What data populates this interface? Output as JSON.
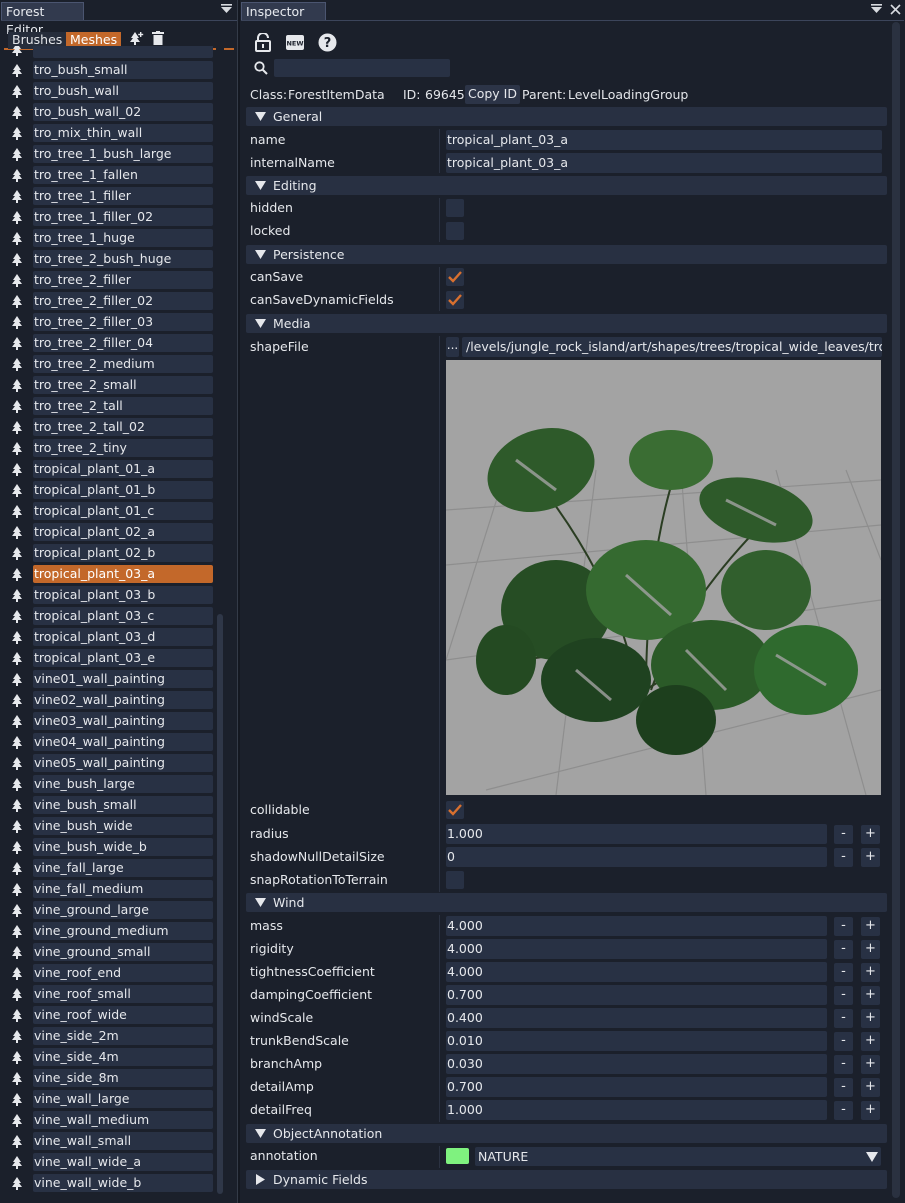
{
  "colors": {
    "accent": "#c3682a",
    "annotation_swatch": "#7ff27f"
  },
  "forest_editor": {
    "title": "Forest Editor",
    "tabs": [
      "Brushes",
      "Meshes"
    ],
    "active_tab": "Meshes",
    "selected_item": "tropical_plant_03_a",
    "items": [
      "tro_bush_small",
      "tro_bush_wall",
      "tro_bush_wall_02",
      "tro_mix_thin_wall",
      "tro_tree_1_bush_large",
      "tro_tree_1_fallen",
      "tro_tree_1_filler",
      "tro_tree_1_filler_02",
      "tro_tree_1_huge",
      "tro_tree_2_bush_huge",
      "tro_tree_2_filler",
      "tro_tree_2_filler_02",
      "tro_tree_2_filler_03",
      "tro_tree_2_filler_04",
      "tro_tree_2_medium",
      "tro_tree_2_small",
      "tro_tree_2_tall",
      "tro_tree_2_tall_02",
      "tro_tree_2_tiny",
      "tropical_plant_01_a",
      "tropical_plant_01_b",
      "tropical_plant_01_c",
      "tropical_plant_02_a",
      "tropical_plant_02_b",
      "tropical_plant_03_a",
      "tropical_plant_03_b",
      "tropical_plant_03_c",
      "tropical_plant_03_d",
      "tropical_plant_03_e",
      "vine01_wall_painting",
      "vine02_wall_painting",
      "vine03_wall_painting",
      "vine04_wall_painting",
      "vine05_wall_painting",
      "vine_bush_large",
      "vine_bush_small",
      "vine_bush_wide",
      "vine_bush_wide_b",
      "vine_fall_large",
      "vine_fall_medium",
      "vine_ground_large",
      "vine_ground_medium",
      "vine_ground_small",
      "vine_roof_end",
      "vine_roof_small",
      "vine_roof_wide",
      "vine_side_2m",
      "vine_side_4m",
      "vine_side_8m",
      "vine_wall_large",
      "vine_wall_medium",
      "vine_wall_small",
      "vine_wall_wide_a",
      "vine_wall_wide_b"
    ]
  },
  "inspector": {
    "title": "Inspector",
    "search": {
      "value": "",
      "placeholder": ""
    },
    "class_label": "Class:",
    "class_value": "ForestItemData",
    "id_label": "ID:",
    "id_value": "69645",
    "copy_id_label": "Copy ID",
    "parent_label": "Parent:",
    "parent_value": "LevelLoadingGroup",
    "sections": {
      "general": "General",
      "editing": "Editing",
      "persistence": "Persistence",
      "media": "Media",
      "wind": "Wind",
      "object_annotation": "ObjectAnnotation",
      "dynamic_fields": "Dynamic Fields"
    },
    "general": {
      "name_label": "name",
      "name_value": "tropical_plant_03_a",
      "internal_name_label": "internalName",
      "internal_name_value": "tropical_plant_03_a"
    },
    "editing": {
      "hidden_label": "hidden",
      "hidden_checked": false,
      "locked_label": "locked",
      "locked_checked": false
    },
    "persistence": {
      "can_save_label": "canSave",
      "can_save_checked": true,
      "can_save_dynamic_label": "canSaveDynamicFields",
      "can_save_dynamic_checked": true
    },
    "media": {
      "shape_file_label": "shapeFile",
      "browse_label": "...",
      "shape_file_value": "/levels/jungle_rock_island/art/shapes/trees/tropical_wide_leaves/tropical_",
      "collidable_label": "collidable",
      "collidable_checked": true,
      "radius_label": "radius",
      "radius_value": "1.000",
      "shadow_null_label": "shadowNullDetailSize",
      "shadow_null_value": "0",
      "snap_label": "snapRotationToTerrain",
      "snap_checked": false
    },
    "wind": [
      {
        "label": "mass",
        "value": "4.000"
      },
      {
        "label": "rigidity",
        "value": "4.000"
      },
      {
        "label": "tightnessCoefficient",
        "value": "4.000"
      },
      {
        "label": "dampingCoefficient",
        "value": "0.700"
      },
      {
        "label": "windScale",
        "value": "0.400"
      },
      {
        "label": "trunkBendScale",
        "value": "0.010"
      },
      {
        "label": "branchAmp",
        "value": "0.030"
      },
      {
        "label": "detailAmp",
        "value": "0.700"
      },
      {
        "label": "detailFreq",
        "value": "1.000"
      }
    ],
    "stepper": {
      "minus": "-",
      "plus": "+"
    },
    "annotation": {
      "label": "annotation",
      "value": "NATURE"
    }
  }
}
